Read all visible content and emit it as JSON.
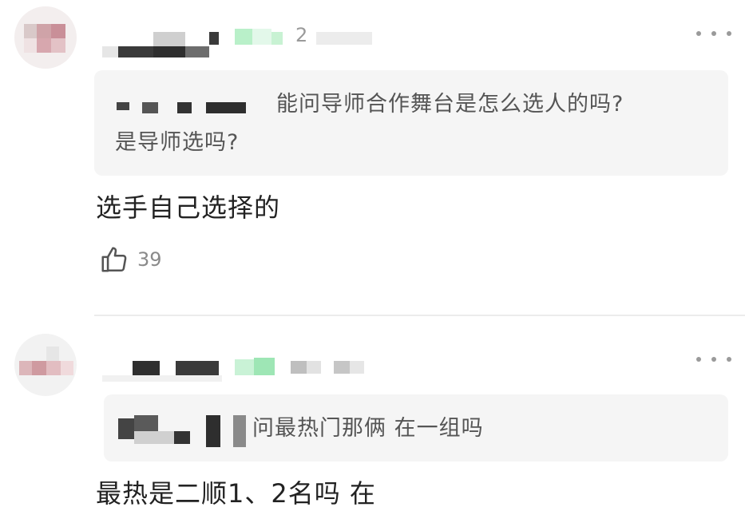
{
  "comments": [
    {
      "quote_line1": "能问导师合作舞台是怎么选人的吗?",
      "quote_line2": "是导师选吗?",
      "reply": "选手自己选择的",
      "likes": "39",
      "time_fragment": "2"
    },
    {
      "quote_line1": "问最热门那俩 在一组吗",
      "reply": "最热是二顺1、2名吗 在"
    }
  ],
  "icons": {
    "more": "more-dots-icon",
    "like": "thumbs-up-icon"
  },
  "colors": {
    "quote_bg": "#f5f5f5",
    "muted_text": "#8a8a8a",
    "divider": "#ececec"
  }
}
